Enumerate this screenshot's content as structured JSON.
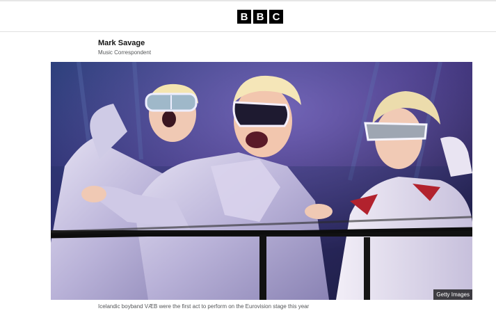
{
  "header": {
    "logo_letters": [
      "B",
      "B",
      "C"
    ],
    "logo_color": "#000000"
  },
  "byline": {
    "author_name": "Mark Savage",
    "author_role": "Music Correspondent"
  },
  "hero": {
    "credit": "Getty Images",
    "caption": "Icelandic boyband VÆB were the first act to perform on the Eurovision stage this year"
  },
  "colors": {
    "stage_bg": "#1a1a35",
    "costume": "#c9c5de",
    "railing": "#111111"
  }
}
